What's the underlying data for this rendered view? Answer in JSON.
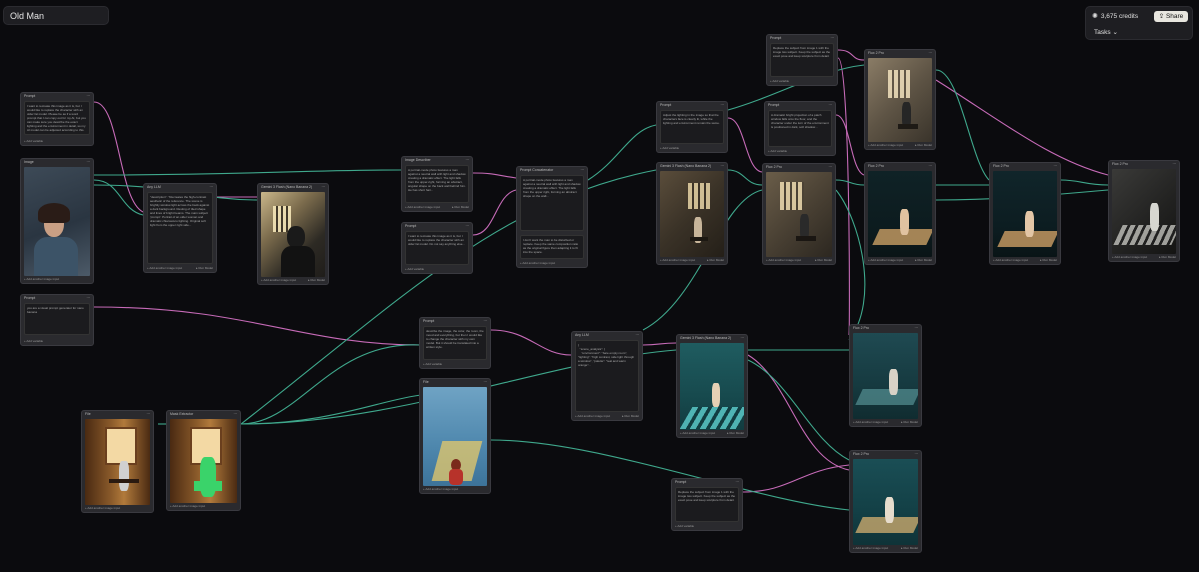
{
  "project": {
    "title": "Old Man"
  },
  "topbar": {
    "credits": "3,675 credits",
    "share": "Share",
    "tasks": "Tasks"
  },
  "labels": {
    "prompt": "Prompt",
    "image": "Image",
    "any_llm": "Any LLM",
    "image_describer": "Image Describer",
    "prompt_concatenator": "Prompt Concatenator",
    "file": "File",
    "mask_extractor": "Mask Extractor",
    "flux2": "Flux 2 Pro",
    "nano_banana": "Gemini 3 Flash (Nano Banana 2)",
    "add_another_image_input": "+ Add another image input",
    "run_model": "▸ Run Model",
    "add_variable": "+ Add variable"
  },
  "texts": {
    "prompt_1": "I want to recreate this image as it is, but I would like to replace the character with an older fat model. Please be as if a word prompt that I can copy out for my AI, but you can make sure you describe the exact lighting and the environment in detail, so my AI model can be adjusted according to this.",
    "prompt_2": "you are a visual prompt generator for nano banana",
    "llm_1_output": "\"description\": \"Recreates the high-contrast aesthetic of the reference. The scene is brightly window light across the back against a dark background. Resting of tiled shape and lines of bright beams. The main subject 'prompt'. Portrait of an older woman and dramatic chiaroscuro lighting. Original soft light from the upper right side...",
    "describer_output": "A portrait-mode photo features a man against a neutral wall with light and shadow creating a dramatic effect. The light falls from the upper-right, forming an abstract, angular shape on the back wall behind him. He has short hair...",
    "prompt_3": "I want to recreate this image as it is, but I would like to replace the character with an older fat model. Do not say anything else...",
    "concat_output": "A portrait-mode photo features a man against a neutral wall with light and shadow creating a dramatic effect. The light falls from the upper right, forming an abstract shape on the wall...",
    "concat_extra": "I don't want the man to be disturbed or replace. Keep the same composition ratio as the original figure then adapting it to fit into the space.",
    "prompt_4": "describe the image, the color, the room, the mood and everything, but then I would like to change the character with my own model. But it should be translated into a written style.",
    "llm_2_output": "{\n  \"scene_analysis\": {\n    \"environment\": \"bare empty room\", \"lighting\": \"high contrast, side light through a window\", \"palette\": \"teal and warm orange\"...",
    "prompt_5": "Adjust the lighting in the image so that the characters face is clearly lit, while the lighting and environment remain the same.",
    "prompt_6": "Replace the subject from image 1 with the image two subject. Keep the subject as the exact pose and keep sculpture from detail.",
    "prompt_7": "A dramatic bright projection of a patch window falls onto the floor, and the character under the turn of the environment is positioned in dark, soft shadow...",
    "prompt_8": "Replace the subject from image 1 with the image two subject. Keep the subject as the exact pose and keep sculpture from detail."
  }
}
